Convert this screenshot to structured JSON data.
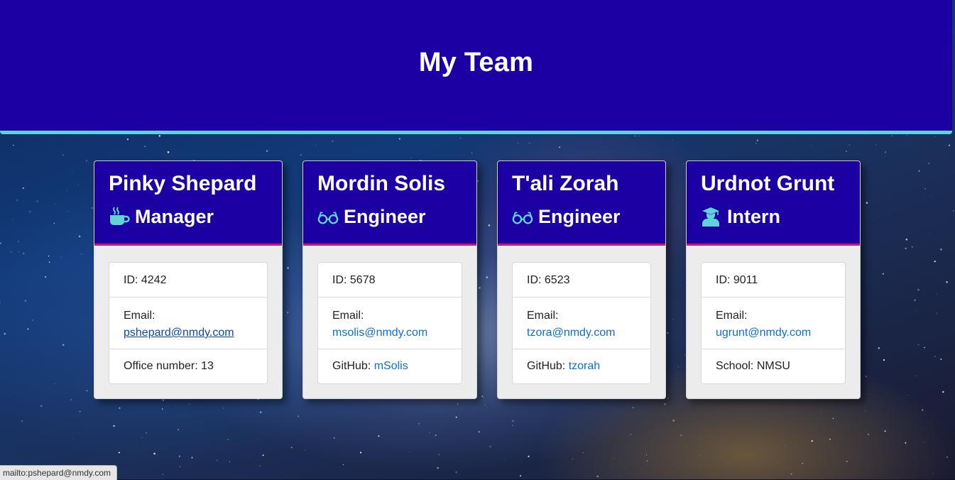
{
  "page": {
    "title": "My Team"
  },
  "colors": {
    "header_bg": "#1c00a3",
    "header_border": "#5fd3d8",
    "card_head_border": "#c2187a",
    "icon": "#5fd3d8",
    "link": "#0c6fd6"
  },
  "cards": [
    {
      "name": "Pinky Shepard",
      "role": "Manager",
      "icon": "coffee-icon",
      "id_text": "ID: 4242",
      "email_label": "Email:",
      "email": "pshepard@nmdy.com",
      "extra_label": "Office number: 13",
      "extra_link": ""
    },
    {
      "name": "Mordin Solis",
      "role": "Engineer",
      "icon": "glasses-icon",
      "id_text": "ID: 5678",
      "email_label": "Email:",
      "email": "msolis@nmdy.com",
      "extra_label": "GitHub: ",
      "extra_link": "mSolis"
    },
    {
      "name": "T'ali Zorah",
      "role": "Engineer",
      "icon": "glasses-icon",
      "id_text": "ID: 6523",
      "email_label": "Email:",
      "email": "tzora@nmdy.com",
      "extra_label": "GitHub: ",
      "extra_link": "tzorah"
    },
    {
      "name": "Urdnot Grunt",
      "role": "Intern",
      "icon": "graduate-icon",
      "id_text": "ID: 9011",
      "email_label": "Email:",
      "email": "ugrunt@nmdy.com",
      "extra_label": "School: NMSU",
      "extra_link": ""
    }
  ],
  "status_bar": {
    "text": "mailto:pshepard@nmdy.com"
  }
}
